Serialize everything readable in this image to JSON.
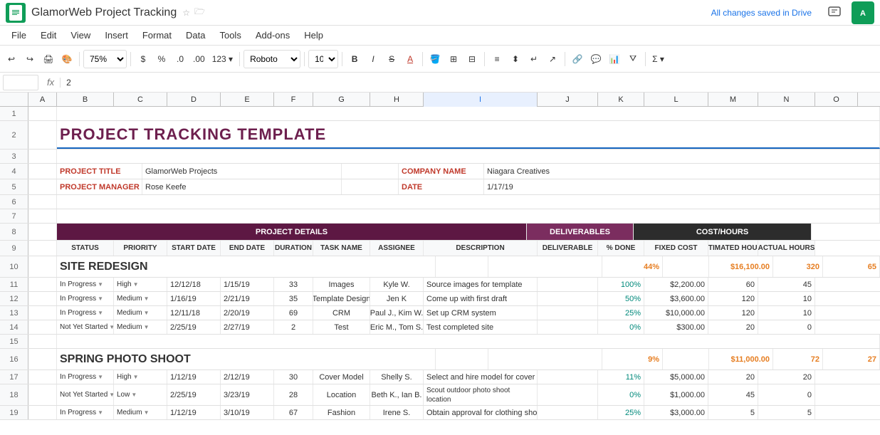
{
  "app": {
    "icon_color": "#0F9D58",
    "title": "GlamorWeb Project Tracking",
    "saved_status": "All changes saved in Drive"
  },
  "menu": {
    "items": [
      "File",
      "Edit",
      "View",
      "Insert",
      "Format",
      "Data",
      "Tools",
      "Add-ons",
      "Help"
    ]
  },
  "toolbar": {
    "zoom": "75%",
    "currency": "$",
    "percent": "%",
    "decimal0": ".0",
    "decimal00": ".00",
    "number123": "123▾",
    "font": "Roboto",
    "font_size": "10",
    "bold": "B",
    "italic": "I",
    "strikethrough": "S"
  },
  "formula_bar": {
    "cell_ref": "",
    "fx": "fx",
    "value": "2"
  },
  "columns": [
    "A",
    "B",
    "C",
    "D",
    "E",
    "F",
    "G",
    "H",
    "I",
    "J",
    "K",
    "L",
    "M",
    "N",
    "O"
  ],
  "sheet": {
    "title": "PROJECT TRACKING TEMPLATE",
    "project_title_label": "PROJECT TITLE",
    "project_title_value": "GlamorWeb Projects",
    "project_manager_label": "PROJECT MANAGER",
    "project_manager_value": "Rose Keefe",
    "company_name_label": "COMPANY NAME",
    "company_name_value": "Niagara Creatives",
    "date_label": "DATE",
    "date_value": "1/17/19",
    "table_header_project_details": "PROJECT DETAILS",
    "table_header_deliverables": "DELIVERABLES",
    "table_header_cost_hours": "COST/HOURS",
    "col_status": "STATUS",
    "col_priority": "PRIORITY",
    "col_start_date": "START DATE",
    "col_end_date": "END DATE",
    "col_duration": "DURATION",
    "col_task_name": "TASK NAME",
    "col_assignee": "ASSIGNEE",
    "col_description": "DESCRIPTION",
    "col_deliverable": "DELIVERABLE",
    "col_pct_done": "% DONE",
    "col_fixed_cost": "FIXED COST",
    "col_est_hours": "ESTIMATED HOURS",
    "col_actual_hours": "ACTUAL HOURS",
    "section1": {
      "name": "SITE REDESIGN",
      "pct": "44%",
      "fixed_cost": "$16,100.00",
      "est_hours": "320",
      "actual_hours": "65",
      "rows": [
        {
          "status": "In Progress",
          "priority": "High",
          "start_date": "12/12/18",
          "end_date": "1/15/19",
          "duration": "33",
          "task_name": "Images",
          "assignee": "Kyle W.",
          "description": "Source images for template",
          "deliverable": "",
          "pct_done": "100%",
          "fixed_cost": "$2,200.00",
          "est_hours": "60",
          "actual_hours": "45"
        },
        {
          "status": "In Progress",
          "priority": "Medium",
          "start_date": "1/16/19",
          "end_date": "2/21/19",
          "duration": "35",
          "task_name": "Template Design",
          "assignee": "Jen K",
          "description": "Come up with first draft",
          "deliverable": "",
          "pct_done": "50%",
          "fixed_cost": "$3,600.00",
          "est_hours": "120",
          "actual_hours": "10"
        },
        {
          "status": "In Progress",
          "priority": "Medium",
          "start_date": "12/11/18",
          "end_date": "2/20/19",
          "duration": "69",
          "task_name": "CRM",
          "assignee": "Paul J., Kim W.",
          "description": "Set up CRM system",
          "deliverable": "",
          "pct_done": "25%",
          "fixed_cost": "$10,000.00",
          "est_hours": "120",
          "actual_hours": "10"
        },
        {
          "status": "Not Yet Started",
          "priority": "Medium",
          "start_date": "2/25/19",
          "end_date": "2/27/19",
          "duration": "2",
          "task_name": "Test",
          "assignee": "Eric M., Tom S.",
          "description": "Test completed site",
          "deliverable": "",
          "pct_done": "0%",
          "fixed_cost": "$300.00",
          "est_hours": "20",
          "actual_hours": "0"
        }
      ]
    },
    "section2": {
      "name": "SPRING PHOTO SHOOT",
      "pct": "9%",
      "fixed_cost": "$11,000.00",
      "est_hours": "72",
      "actual_hours": "27",
      "rows": [
        {
          "status": "In Progress",
          "priority": "High",
          "start_date": "1/12/19",
          "end_date": "2/12/19",
          "duration": "30",
          "task_name": "Cover Model",
          "assignee": "Shelly S.",
          "description": "Select and hire model for cover",
          "deliverable": "",
          "pct_done": "11%",
          "fixed_cost": "$5,000.00",
          "est_hours": "20",
          "actual_hours": "20"
        },
        {
          "status": "Not Yet Started",
          "priority": "Low",
          "start_date": "2/25/19",
          "end_date": "3/23/19",
          "duration": "28",
          "task_name": "Location",
          "assignee": "Beth K., Ian B.",
          "description": "Scout outdoor photo shoot location",
          "deliverable": "",
          "pct_done": "0%",
          "fixed_cost": "$1,000.00",
          "est_hours": "45",
          "actual_hours": "0"
        },
        {
          "status": "In Progress",
          "priority": "Medium",
          "start_date": "1/12/19",
          "end_date": "3/10/19",
          "duration": "67",
          "task_name": "Fashion",
          "assignee": "Irene S.",
          "description": "Obtain approval for clothing shoot",
          "deliverable": "",
          "pct_done": "25%",
          "fixed_cost": "$3,000.00",
          "est_hours": "5",
          "actual_hours": "5"
        }
      ]
    }
  }
}
